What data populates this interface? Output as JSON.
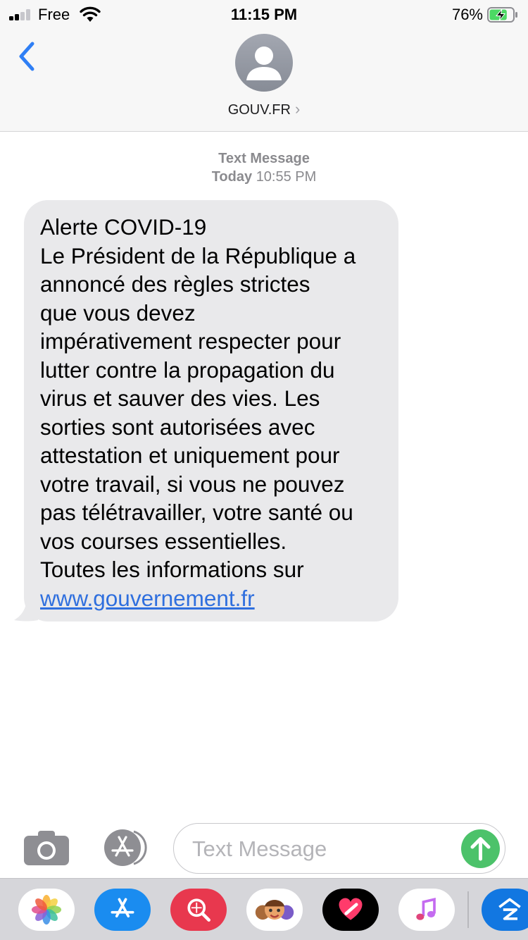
{
  "status_bar": {
    "carrier": "Free",
    "time": "11:15 PM",
    "battery_percent": "76%",
    "battery_level": 0.76,
    "signal_bars": 2,
    "charging": true
  },
  "header": {
    "contact_name": "GOUV.FR",
    "chevron": "›",
    "back_icon": "chevron-left-icon",
    "avatar_icon": "person-silhouette-icon"
  },
  "conversation": {
    "kind_label": "Text Message",
    "day_label": "Today",
    "time_label": "10:55 PM",
    "message": {
      "lines": [
        "Alerte COVID-19",
        "Le Président de la République a",
        "annoncé des règles strictes",
        "que vous devez",
        "impérativement respecter pour",
        "lutter contre la propagation du",
        "virus et sauver des vies. Les",
        "sorties sont autorisées avec",
        "attestation et uniquement pour",
        "votre travail, si vous ne pouvez",
        "pas télétravailler, votre santé ou",
        "vos courses essentielles.",
        "Toutes les informations sur"
      ],
      "link": "www.gouvernement.fr"
    }
  },
  "input_bar": {
    "placeholder": "Text Message",
    "camera_icon": "camera-icon",
    "app_store_icon": "app-store-icon",
    "send_icon": "arrow-up-icon"
  },
  "app_drawer": {
    "apps": [
      "photos-icon",
      "app-store-icon",
      "web-search-icon",
      "memoji-stickers-icon",
      "digital-touch-icon",
      "music-icon",
      "zillow-icon"
    ]
  },
  "colors": {
    "accent_blue": "#2f7ff5",
    "link_blue": "#2f6fde",
    "send_green": "#4cc26a",
    "bubble_gray": "#e9e9eb",
    "battery_green": "#4cd964"
  }
}
